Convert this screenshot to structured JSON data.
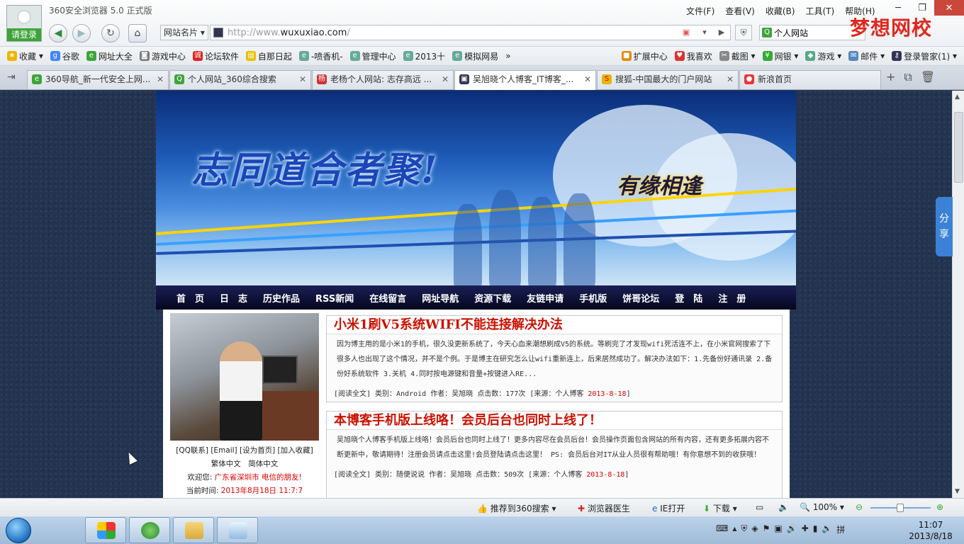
{
  "browser": {
    "app_title": "360安全浏览器 5.0 正式版",
    "login_label": "请登录",
    "menus": [
      "文件(F)",
      "查看(V)",
      "收藏(B)",
      "工具(T)",
      "帮助(H)"
    ],
    "site_card_label": "网站名片",
    "address_prefix": "http://www.",
    "address_domain": "wuxuxiao.com",
    "address_suffix": "/",
    "search_value": "个人网站",
    "watermark": "梦想网校"
  },
  "bookmarks": {
    "left": [
      "收藏",
      "谷歌",
      "网址大全",
      "游戏中心",
      "论坛软件",
      "自那日起",
      "-喷香机-",
      "管理中心",
      "2013十",
      "模拟网易"
    ],
    "right": [
      "扩展中心",
      "我喜欢",
      "截图",
      "网银",
      "游戏",
      "邮件",
      "登录管家(1)"
    ]
  },
  "tabs": [
    {
      "title": "360导航_新一代安全上网...",
      "active": false
    },
    {
      "title": "个人网站_360综合搜索",
      "active": false
    },
    {
      "title": "老杨个人网站: 志存高远 ...",
      "active": false
    },
    {
      "title": "吴旭晓个人博客_IT博客_...",
      "active": true
    },
    {
      "title": "搜狐-中国最大的门户网站",
      "active": false
    },
    {
      "title": "新浪首页",
      "active": false
    }
  ],
  "share_label": "分享",
  "site": {
    "slogan": "志同道合者聚!",
    "slogan2": "有缘相逢",
    "nav": [
      "首　页",
      "日　志",
      "历史作品",
      "RSS新闻",
      "在线留言",
      "网址导航",
      "资源下载",
      "友链申请",
      "手机版",
      "饼哥论坛",
      "登　陆",
      "注　册"
    ],
    "side_links_line1": "[QQ联系] [Email] [设为首页] [加入收藏]",
    "side_links_line2": "繁体中文　简体中文",
    "welcome_label": "欢迎您: ",
    "welcome_value": "广东省深圳市 电信的朋友!",
    "time_label": "当前时间: ",
    "time_value": "2013年8月18日 11:7:7",
    "posts": [
      {
        "title": "小米1刷V5系统WIFI不能连接解决办法",
        "summary": "因为博主用的是小米1的手机，很久没更新系统了，今天心血来潮想刷成V5的系统。等刷完了才发现wifi死活连不上，在小米官网搜索了下很多人也出现了这个情况，并不是个例。于是博主在研究怎么让wifi重新连上，后来居然成功了。解决办法如下：1.先备份好通讯录 2.备份好系统软件 3.关机 4.同时按电源键和音量+按键进入RE...",
        "meta_prefix": "[阅读全文] 类别：Android 作者：吴旭晓 点击数：177次 [来源：个人博客 ",
        "date": "2013-8-18",
        "meta_suffix": "]"
      },
      {
        "title": "本博客手机版上线咯！会员后台也同时上线了！",
        "summary": "吴旭晓个人博客手机版上线咯！会员后台也同时上线了！更多内容尽在会员后台！会员操作页面包含网站的所有内容，还有更多拓展内容不断更新中，敬请期待！注册会员请点击这里!会员登陆请点击这里！ PS: 会员后台对IT从业人员很有帮助哦！有你意想不到的收获哦！",
        "meta_prefix": "[阅读全文] 类别：随便说说 作者：吴旭晓 点击数：509次 [来源：个人博客 ",
        "date": "2013-8-18",
        "meta_suffix": "]"
      }
    ]
  },
  "statusbar": {
    "recommend": "推荐到360搜索",
    "doctor": "浏览器医生",
    "ie_open": "IE打开",
    "download": "下载",
    "zoom": "100%"
  },
  "taskbar": {
    "time": "11:07",
    "date": "2013/8/18"
  }
}
